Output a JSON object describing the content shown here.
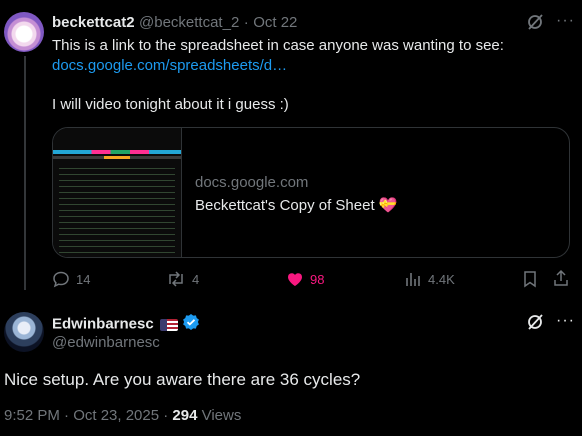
{
  "reply_tweet": {
    "display_name": "beckettcat2",
    "handle": "@beckettcat_2",
    "separator": "·",
    "date": "Oct 22",
    "text_line1": "This is a link to the spreadsheet in case anyone was wanting to see:",
    "link_text": "docs.google.com/spreadsheets/d…",
    "text_line2": "I will video tonight about it i guess :)",
    "card": {
      "domain": "docs.google.com",
      "title": "Beckettcat's Copy of Sheet 💝"
    },
    "actions": {
      "replies": "14",
      "reposts": "4",
      "likes": "98",
      "views": "4.4K"
    }
  },
  "main_tweet": {
    "display_name": "Edwinbarnesc",
    "handle": "@edwinbarnesc",
    "text": "Nice setup. Are you aware there are 36 cycles?",
    "timestamp": "9:52 PM · Oct 23, 2025 · ",
    "views_count": "294",
    "views_label": " Views"
  },
  "colors": {
    "accent": "#1d9bf0",
    "like": "#f91880",
    "muted": "#71767b",
    "text": "#e7e9ea",
    "background": "#000000"
  },
  "icons": [
    "grok-icon",
    "reply-icon",
    "repost-icon",
    "heart-icon",
    "views-icon",
    "bookmark-icon",
    "share-icon",
    "verified-badge-icon",
    "us-flag-icon"
  ]
}
